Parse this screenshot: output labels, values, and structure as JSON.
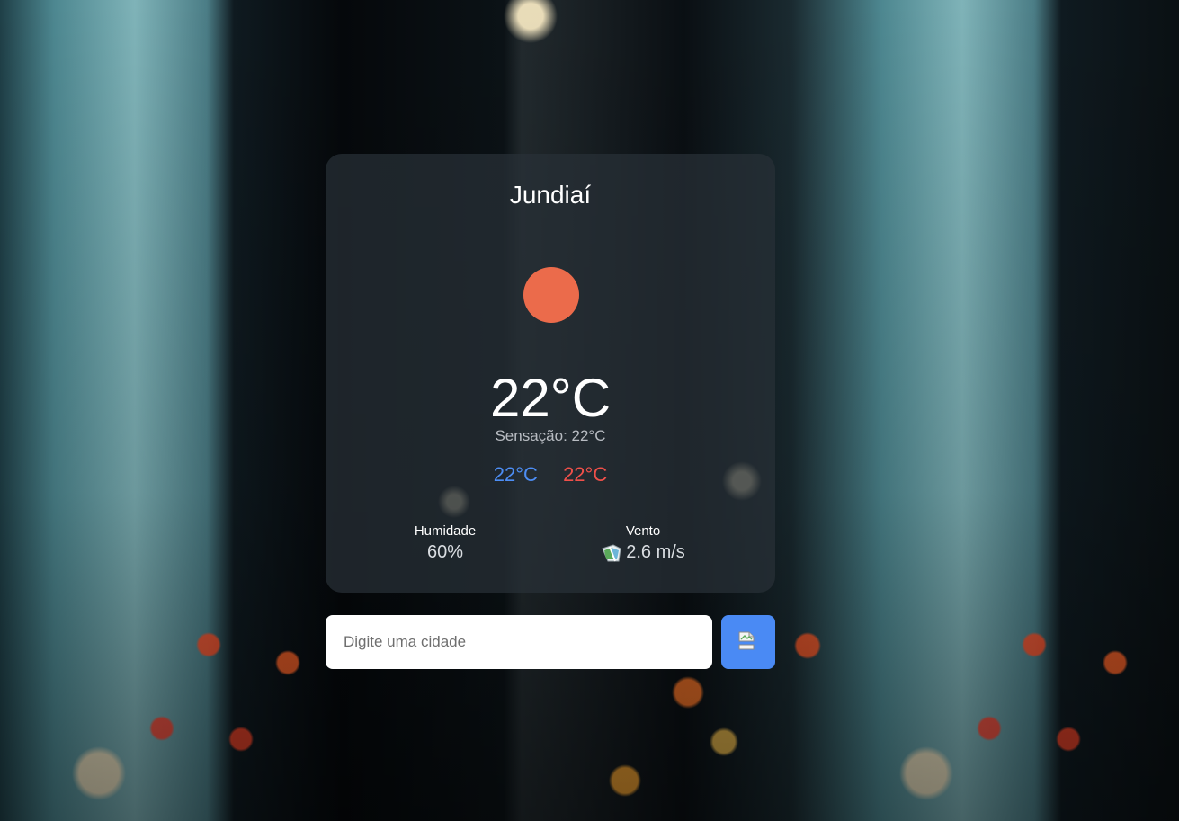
{
  "city": "Jundiaí",
  "weather_icon": "sun-icon",
  "temperature": "22°C",
  "feels_like": "Sensação: 22°C",
  "temp_min": "22°C",
  "temp_max": "22°C",
  "humidity": {
    "label": "Humidade",
    "value": "60%"
  },
  "wind": {
    "label": "Vento",
    "value": "2.6 m/s",
    "icon": "broken-image-icon"
  },
  "search": {
    "placeholder": "Digite uma cidade",
    "value": "",
    "button_icon": "broken-image-icon"
  },
  "colors": {
    "accent": "#4a8af4",
    "min_temp": "#4d8ef5",
    "max_temp": "#f0504a",
    "sun": "#eb6b4b"
  }
}
